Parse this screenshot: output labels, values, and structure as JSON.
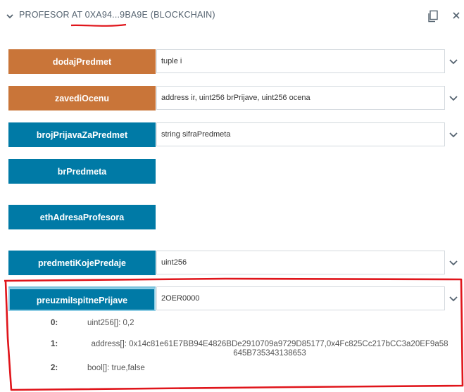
{
  "header": {
    "title": "PROFESOR AT 0XA94...9BA9E (BLOCKCHAIN)",
    "copy_icon": "copy-icon",
    "close_icon": "close-icon",
    "collapse_icon": "chevron-down-icon"
  },
  "functions": [
    {
      "label": "dodajPredmet",
      "kind": "transact",
      "placeholder": "tuple i",
      "value": "",
      "expandable": true
    },
    {
      "label": "zavediOcenu",
      "kind": "transact",
      "placeholder": "address ir, uint256 brPrijave, uint256 ocena",
      "value": "",
      "expandable": true
    },
    {
      "label": "brojPrijavaZaPredmet",
      "kind": "call",
      "placeholder": "string sifraPredmeta",
      "value": "",
      "expandable": true
    },
    {
      "label": "brPredmeta",
      "kind": "call",
      "placeholder": "",
      "value": "",
      "expandable": false
    },
    {
      "label": "ethAdresaProfesora",
      "kind": "call",
      "placeholder": "",
      "value": "",
      "expandable": false
    },
    {
      "label": "predmetiKojePredaje",
      "kind": "call",
      "placeholder": "uint256",
      "value": "",
      "expandable": true
    },
    {
      "label": "preuzmiIspitnePrijave",
      "kind": "call",
      "placeholder": "",
      "value": "2OER0000",
      "expandable": true
    }
  ],
  "outputs": [
    {
      "index": "0:",
      "value": "uint256[]: 0,2"
    },
    {
      "index": "1:",
      "value": "address[]: 0x14c81e61E7BB94E4826BDe2910709a9729D85177,0x4Fc825Cc217bCC3a20EF9a58645B735343138653"
    },
    {
      "index": "2:",
      "value": "bool[]: true,false"
    }
  ],
  "colors": {
    "transact": "#c97539",
    "call": "#007aa6",
    "annotation": "#e0151b"
  }
}
